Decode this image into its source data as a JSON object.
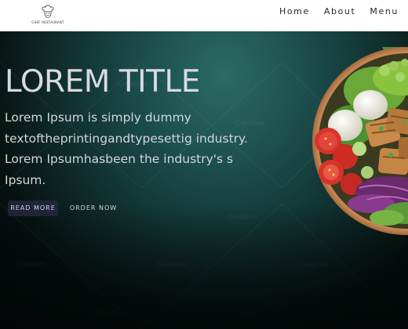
{
  "header": {
    "logo_text": "CHEF RESTAURANT",
    "nav": [
      {
        "label": "Home"
      },
      {
        "label": "About"
      },
      {
        "label": "Menu"
      }
    ]
  },
  "hero": {
    "title": "LOREM TITLE",
    "body_lines": [
      "Lorem Ipsum is simply dummy",
      "textoftheprintingandtypesettig industry.",
      "Lorem Ipsumhasbeen the industry's s",
      "Ipsum."
    ],
    "buttons": {
      "read_more": "READ MORE",
      "order_now": "ORDER NOW"
    },
    "watermark": "Creative"
  },
  "colors": {
    "header_bg": "#ffffff",
    "hero_teal": "#1c4f4d",
    "hero_dark": "#020606",
    "text_light": "#d7dbe0",
    "read_more_bg": "#23263c"
  },
  "icons": {
    "logo": "chef-hat-icon",
    "hero_image": "salad-bowl-image"
  }
}
